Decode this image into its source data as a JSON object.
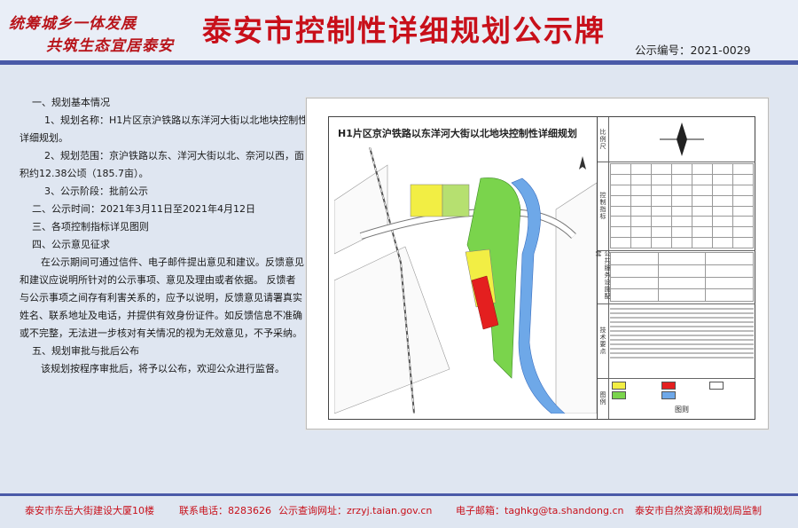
{
  "header": {
    "slogan_line1": "统筹城乡一体发展",
    "slogan_line2": "共筑生态宜居泰安",
    "title": "泰安市控制性详细规划公示牌",
    "notice_number": "公示编号：2021-0029"
  },
  "sections": {
    "s1_heading": "一、规划基本情况",
    "s1_item1_a": "1、规划名称：H1片区京沪铁路以东洋河大街以北地块控制性",
    "s1_item1_b": "详细规划。",
    "s1_item2_a": "2、规划范围：京沪铁路以东、洋河大街以北、奈河以西，面",
    "s1_item2_b": "积约12.38公顷（185.7亩）。",
    "s1_item3": "3、公示阶段：批前公示",
    "s2": "二、公示时间：2021年3月11日至2021年4月12日",
    "s3": "三、各项控制指标详见图则",
    "s4_heading": "四、公示意见征求",
    "s4_p1": "在公示期间可通过信件、电子邮件提出意见和建议。反馈意见",
    "s4_p2": "和建议应说明所针对的公示事项、意见及理由或者依据。 反馈者",
    "s4_p3": "与公示事项之间存有利害关系的，应予以说明，反馈意见请署真实",
    "s4_p4": "姓名、联系地址及电话，并提供有效身份证件。如反馈信息不准确",
    "s4_p5": "或不完整，无法进一步核对有关情况的视为无效意见，不予采纳。",
    "s5_heading": "五、规划审批与批后公布",
    "s5_p1": "该规划按程序审批后，将予以公布，欢迎公众进行监督。"
  },
  "drawing": {
    "title": "H1片区京沪铁路以东洋河大街以北地块控制性详细规划",
    "side_labels": [
      "比例尺",
      "控制指标",
      "公共服务设施配套",
      "技术要点",
      "图例"
    ],
    "legend_caption": "图则"
  },
  "colors": {
    "title_red": "#c8101a",
    "bar_blue": "#4a5aa8",
    "land_yellow": "#f2ee44",
    "land_green": "#7ad44c",
    "land_red": "#e41f1f",
    "river_blue": "#6ea8e8"
  },
  "footer": {
    "address": "泰安市东岳大街建设大厦10楼",
    "phone": "联系电话：8283626",
    "website": "公示查询网址：zrzyj.taian.gov.cn",
    "email": "电子邮箱：taghkg@ta.shandong.cn",
    "supervisor": "泰安市自然资源和规划局监制"
  }
}
